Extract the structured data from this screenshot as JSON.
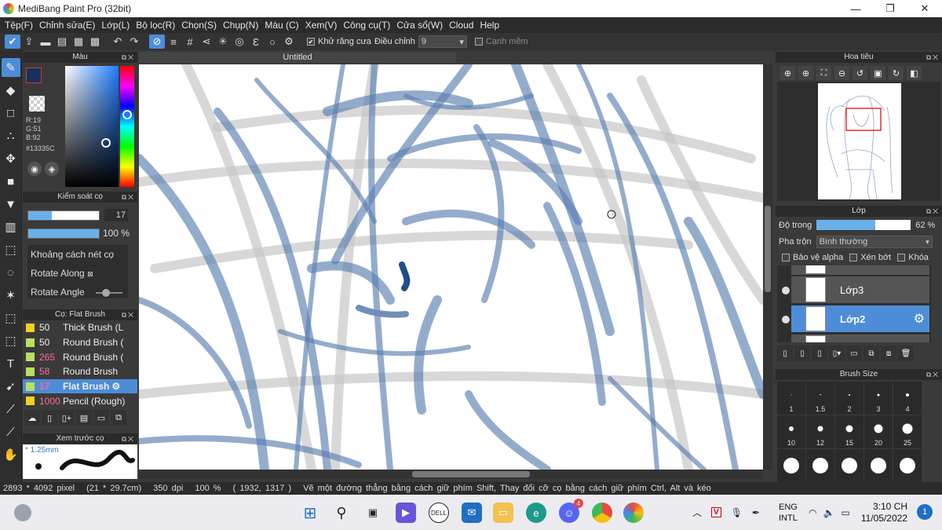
{
  "window": {
    "title": "MediBang Paint Pro (32bit)",
    "minimize": "—",
    "maximize": "❐",
    "close": "✕"
  },
  "menu": [
    "Tệp(F)",
    "Chỉnh sửa(E)",
    "Lớp(L)",
    "Bộ lọc(R)",
    "Chọn(S)",
    "Chụp(N)",
    "Màu (C)",
    "Xem(V)",
    "Công cụ(T)",
    "Cửa sổ(W)",
    "Cloud",
    "Help"
  ],
  "toolbar": {
    "antialias_label": "Khử răng cưa",
    "antialias_checked": true,
    "adjust_label": "Điều chỉnh",
    "adjust_value": "9",
    "edge_label": "Cạnh mềm",
    "edge_checked": false
  },
  "color_panel": {
    "title": "Màu",
    "r": "R:19",
    "g": "G:51",
    "b": "B:92",
    "hex": "#13335C",
    "fg_color": "#13335c"
  },
  "brush_control": {
    "title": "Kiểm soát cọ",
    "size_value": "17",
    "size_fraction": 0.33,
    "opacity_value": "100 %",
    "opacity_fraction": 1.0,
    "props": [
      "Khoảng cách nét cọ",
      "Rotate Along",
      "Rotate Angle"
    ]
  },
  "brush_list": {
    "title": "Cọ: Flat Brush",
    "items": [
      {
        "size": "50",
        "name": "Thick Brush (L",
        "color": "#f0d020"
      },
      {
        "size": "50",
        "name": "Round Brush (",
        "color": "#b8e060"
      },
      {
        "size": "265",
        "name": "Round Brush (",
        "color": "#b8e060"
      },
      {
        "size": "58",
        "name": "Round Brush",
        "color": "#b8e060"
      },
      {
        "size": "17",
        "name": "Flat Brush",
        "color": "#b8e060"
      },
      {
        "size": "1000",
        "name": "Pencil (Rough)",
        "color": "#f0d020"
      }
    ],
    "selected_index": 4
  },
  "preview": {
    "title": "Xem trước cọ",
    "size": "* 1.25mm"
  },
  "canvas": {
    "tab": "Untitled",
    "stroke_color": "#5b7fb0"
  },
  "navigator": {
    "title": "Hoa tiêu"
  },
  "layers": {
    "title": "Lớp",
    "opacity_label": "Độ trong",
    "opacity_value": "62 %",
    "opacity_fraction": 0.62,
    "blend_label": "Pha trộn",
    "blend_value": "Bình thường",
    "checks": [
      "Bảo vệ alpha",
      "Xén bớt",
      "Khóa"
    ],
    "items": [
      {
        "name": "Lớp3"
      },
      {
        "name": "Lớp2"
      }
    ],
    "selected": "Lớp2"
  },
  "brush_size": {
    "title": "Brush Size",
    "labels": [
      "1",
      "1.5",
      "2",
      "3",
      "4",
      "10",
      "12",
      "15",
      "20",
      "25",
      "",
      "",
      "",
      "",
      ""
    ]
  },
  "status": {
    "pixels": "2893 * 4092 pixel",
    "cm": "(21 * 29.7cm)",
    "dpi": "350 dpi",
    "zoom": "100 %",
    "coords": "( 1932, 1317 )",
    "hint": "Vẽ một đường thẳng bằng cách giữ phím Shift, Thay đổi cỡ cọ bằng cách giữ phím Ctrl, Alt và kéo"
  },
  "taskbar": {
    "lang_line1": "ENG",
    "lang_line2": "INTL",
    "time": "3:10 CH",
    "date": "11/05/2022",
    "notification_count": "1",
    "discord_badge": "4"
  }
}
